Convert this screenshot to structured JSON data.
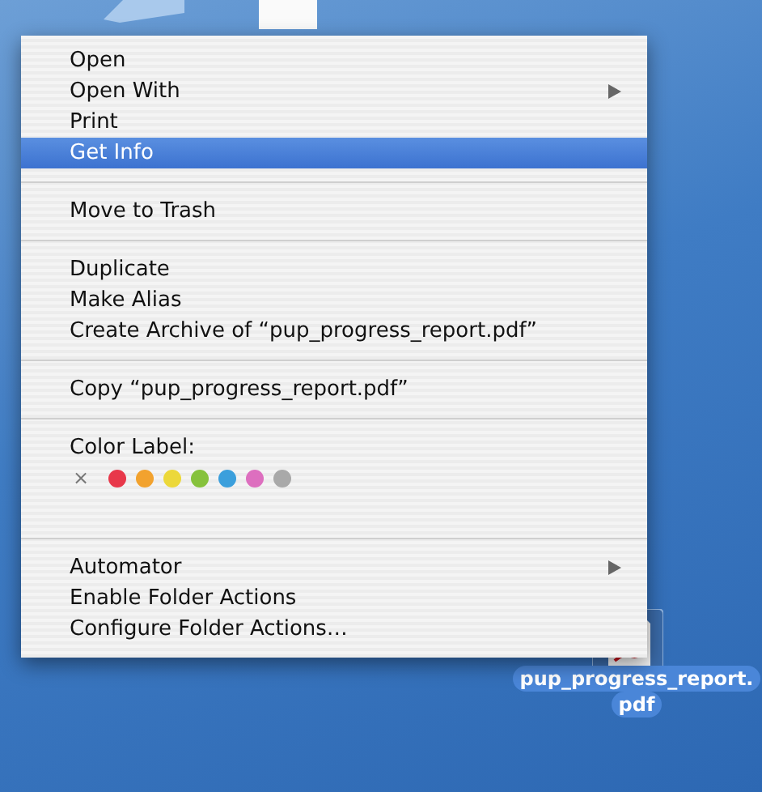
{
  "menu": {
    "items": [
      {
        "kind": "item",
        "label": "Open",
        "selected": false,
        "submenu": false
      },
      {
        "kind": "item",
        "label": "Open With",
        "selected": false,
        "submenu": true
      },
      {
        "kind": "item",
        "label": "Print",
        "selected": false,
        "submenu": false
      },
      {
        "kind": "item",
        "label": "Get Info",
        "selected": true,
        "submenu": false
      },
      {
        "kind": "separator"
      },
      {
        "kind": "item",
        "label": "Move to Trash",
        "selected": false,
        "submenu": false
      },
      {
        "kind": "separator"
      },
      {
        "kind": "item",
        "label": "Duplicate",
        "selected": false,
        "submenu": false
      },
      {
        "kind": "item",
        "label": "Make Alias",
        "selected": false,
        "submenu": false
      },
      {
        "kind": "item",
        "label": "Create Archive of “pup_progress_report.pdf”",
        "selected": false,
        "submenu": false
      },
      {
        "kind": "separator"
      },
      {
        "kind": "item",
        "label": "Copy “pup_progress_report.pdf”",
        "selected": false,
        "submenu": false
      },
      {
        "kind": "separator"
      },
      {
        "kind": "heading",
        "label": "Color Label:"
      },
      {
        "kind": "colors",
        "none_label": "×",
        "colors": [
          {
            "color": "#e8384a"
          },
          {
            "color": "#f2a22e"
          },
          {
            "color": "#ecd83a"
          },
          {
            "color": "#86c23c"
          },
          {
            "color": "#3b9fdc"
          },
          {
            "color": "#dd6fbf"
          },
          {
            "color": "#a9a9a9"
          }
        ]
      },
      {
        "kind": "separator"
      },
      {
        "kind": "item",
        "label": "Automator",
        "selected": false,
        "submenu": true
      },
      {
        "kind": "item",
        "label": "Enable Folder Actions",
        "selected": false,
        "submenu": false
      },
      {
        "kind": "item",
        "label": "Configure Folder Actions…",
        "selected": false,
        "submenu": false
      }
    ]
  },
  "desktop_file": {
    "name_lines": [
      "pup_progress_report.",
      "pdf"
    ],
    "selected": true
  }
}
